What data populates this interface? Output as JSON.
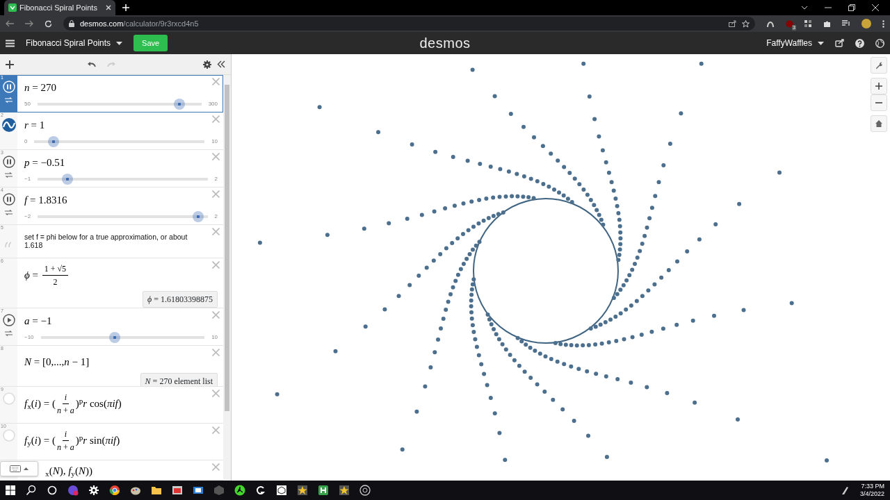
{
  "browser": {
    "tab_title": "Fibonacci Spiral Points",
    "url_domain": "desmos.com",
    "url_path": "/calculator/9r3rxcd4n5",
    "extension_badge": "3"
  },
  "header": {
    "graph_title": "Fibonacci Spiral Points",
    "save_label": "Save",
    "logo": "desmos",
    "user": "FaffyWaffles"
  },
  "expressions": [
    {
      "number": "1",
      "kind": "slider",
      "selected": true,
      "playing": true,
      "loop": true,
      "math": "*n* = 270",
      "min": "50",
      "max": "300",
      "level": 0.88
    },
    {
      "number": "2",
      "kind": "slider",
      "selected": false,
      "loop": false,
      "math": "*r* = 1",
      "min": "0",
      "max": "10",
      "level": 0.1
    },
    {
      "number": "3",
      "kind": "slider",
      "selected": false,
      "playing": true,
      "loop": true,
      "math": "*p* = −0.51",
      "min": "−1",
      "max": "2",
      "level": 0.163
    },
    {
      "number": "4",
      "kind": "slider",
      "selected": false,
      "playing": true,
      "loop": true,
      "math": "*f* = 1.8316",
      "min": "−2",
      "max": "2",
      "level": 0.958
    },
    {
      "number": "5",
      "kind": "note",
      "selected": false,
      "text": "set f = phi below for a true approximation, or about 1.618"
    },
    {
      "number": "6",
      "kind": "expression",
      "selected": false,
      "parts": [
        {
          "kind": "text",
          "text": "*ϕ* = "
        },
        {
          "kind": "frac",
          "num": "1 + √5",
          "den": "2"
        }
      ],
      "result": "*ϕ* = 1.61803398875"
    },
    {
      "number": "7",
      "kind": "slider",
      "selected": false,
      "playing": false,
      "loop": true,
      "math": "*a* = −1",
      "min": "−10",
      "max": "10",
      "level": 0.45
    },
    {
      "number": "8",
      "kind": "expression",
      "selected": false,
      "parts": [
        {
          "kind": "text",
          "text": "*N* = [0,...,*n* − 1]"
        }
      ],
      "result": "*N* = 270 element list"
    },
    {
      "number": "9",
      "kind": "expression",
      "selected": false,
      "hidden": true,
      "parts": [
        {
          "kind": "text",
          "text": "*f*$_{x}$(*i*) = ("
        },
        {
          "kind": "frac",
          "num": "*i*",
          "den": "*n* + *a*"
        },
        {
          "kind": "text",
          "text": ")$^{p}$*r* cos(*πif*)"
        }
      ]
    },
    {
      "number": "10",
      "kind": "expression",
      "selected": false,
      "hidden": true,
      "parts": [
        {
          "kind": "text",
          "text": "*f*$_{y}$(*i*) = ("
        },
        {
          "kind": "frac",
          "num": "*i*",
          "den": "*n* + *a*"
        },
        {
          "kind": "text",
          "text": ")$^{p}$*r* sin(*πif*)"
        }
      ]
    },
    {
      "kind": "expression",
      "selected": false,
      "parts": [
        {
          "kind": "text",
          "text": "$_{x}$(*N*), *f*$_{y}$(*N*))"
        }
      ]
    }
  ],
  "taskbar": {
    "time": "7:33 PM",
    "date": "3/4/2022"
  }
}
